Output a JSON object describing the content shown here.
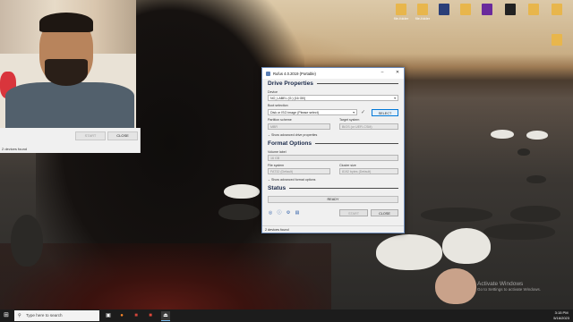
{
  "desktop": {
    "icons": [
      {
        "label": "file-folder",
        "icon": "folder-icon",
        "color": "#e8b64c"
      },
      {
        "label": "file-folder",
        "icon": "folder-icon",
        "color": "#e8b64c"
      },
      {
        "label": "",
        "icon": "app-icon",
        "color": "#2b3f78"
      },
      {
        "label": "",
        "icon": "folder-icon",
        "color": "#e8b64c"
      },
      {
        "label": "",
        "icon": "app-icon",
        "color": "#6a2a9c"
      },
      {
        "label": "",
        "icon": "app-icon",
        "color": "#222"
      },
      {
        "label": "",
        "icon": "folder-icon",
        "color": "#e8b64c"
      },
      {
        "label": "",
        "icon": "folder-icon",
        "color": "#e8b64c"
      }
    ]
  },
  "bg_panel": {
    "start_label": "START",
    "close_label": "CLOSE",
    "status": "2 devices found"
  },
  "rufus": {
    "title": "Rufus 4.0.2019 (Portable)",
    "drive_properties": "Drive Properties",
    "device_label": "Device",
    "device_value": "NO_LABEL (G:) [16 GB]",
    "boot_selection_label": "Boot selection",
    "boot_selection_value": "Disk or ISO image (Please select)",
    "select_label": "SELECT",
    "partition_scheme_label": "Partition scheme",
    "partition_scheme_value": "MBR",
    "target_system_label": "Target system",
    "target_system_value": "BIOS (or UEFI-CSM)",
    "advanced_drive": "Show advanced drive properties",
    "format_options": "Format Options",
    "volume_label_label": "Volume label",
    "volume_label_value": "16 GB",
    "file_system_label": "File system",
    "file_system_value": "FAT32 (Default)",
    "cluster_size_label": "Cluster size",
    "cluster_size_value": "8192 bytes (Default)",
    "advanced_format": "Show advanced format options",
    "status_title": "Status",
    "ready": "READY",
    "start_label": "START",
    "close_label": "CLOSE",
    "status_bar": "2 devices found"
  },
  "activate": {
    "title": "Activate Windows",
    "subtitle": "Go to Settings to activate Windows."
  },
  "taskbar": {
    "search_placeholder": "Type here to search",
    "time": "3:15 PM",
    "date": "5/16/2023"
  }
}
